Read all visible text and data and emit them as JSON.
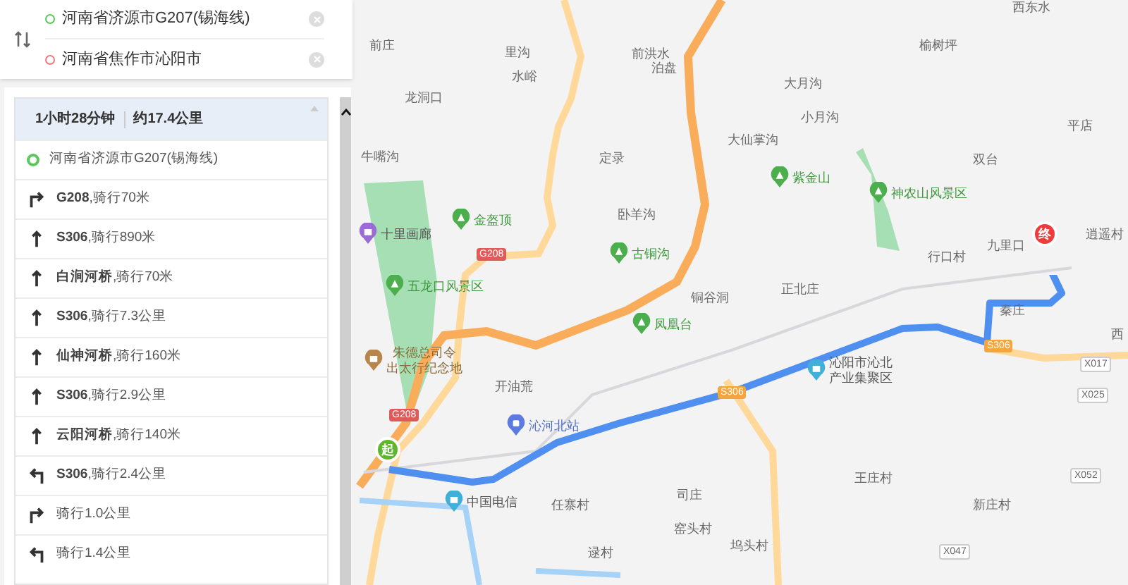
{
  "route_inputs": [
    {
      "kind": "start",
      "value": "河南省济源市G207(锡海线)"
    },
    {
      "kind": "end",
      "value": "河南省焦作市沁阳市"
    }
  ],
  "summary": {
    "duration": "1小时28分钟",
    "distance": "约17.4公里"
  },
  "steps": [
    {
      "kind": "start",
      "text": "河南省济源市G207(锡海线)"
    },
    {
      "kind": "right",
      "text": "**G208**,骑行70米"
    },
    {
      "kind": "straight",
      "text": "**S306**,骑行890米"
    },
    {
      "kind": "straight",
      "text": "**白涧河桥**,骑行70米"
    },
    {
      "kind": "straight",
      "text": "**S306**,骑行7.3公里"
    },
    {
      "kind": "straight",
      "text": "**仙神河桥**,骑行160米"
    },
    {
      "kind": "straight",
      "text": "**S306**,骑行2.9公里"
    },
    {
      "kind": "straight",
      "text": "**云阳河桥**,骑行140米"
    },
    {
      "kind": "left",
      "text": "**S306**,骑行2.4公里"
    },
    {
      "kind": "right",
      "text": "骑行1.0公里"
    },
    {
      "kind": "left",
      "text": "骑行1.4公里"
    }
  ],
  "map": {
    "start_marker": "起",
    "end_marker": "终",
    "labels": [
      {
        "kind": "place",
        "lines": [
          "前洪水"
        ]
      },
      {
        "kind": "place",
        "lines": [
          "前庄"
        ]
      },
      {
        "kind": "place",
        "lines": [
          "里沟"
        ]
      },
      {
        "kind": "place",
        "lines": [
          "水峪"
        ]
      },
      {
        "kind": "place",
        "lines": [
          "龙洞口"
        ]
      },
      {
        "kind": "place",
        "lines": [
          "泊盘"
        ]
      },
      {
        "kind": "place",
        "lines": [
          "大仙掌沟"
        ]
      },
      {
        "kind": "place",
        "lines": [
          "牛嘴沟"
        ]
      },
      {
        "kind": "place",
        "lines": [
          "定录"
        ]
      },
      {
        "kind": "shop",
        "lines": [
          "十里画廊"
        ]
      },
      {
        "kind": "scenic",
        "lines": [
          "金盔顶"
        ]
      },
      {
        "kind": "place",
        "lines": [
          "卧羊沟"
        ]
      },
      {
        "kind": "scenic",
        "lines": [
          "古铜沟"
        ]
      },
      {
        "kind": "scenic",
        "lines": [
          "五龙口风景区"
        ]
      },
      {
        "kind": "place",
        "lines": [
          "铜谷洞"
        ]
      },
      {
        "kind": "scenic",
        "lines": [
          "凤凰台"
        ]
      },
      {
        "kind": "memorial",
        "lines": [
          "朱德总司令",
          "出太行纪念地"
        ]
      },
      {
        "kind": "place",
        "lines": [
          "开油荒"
        ]
      },
      {
        "kind": "station",
        "lines": [
          "沁河北站"
        ]
      },
      {
        "kind": "telecom",
        "lines": [
          "中国电信"
        ]
      },
      {
        "kind": "place",
        "lines": [
          "任寨村"
        ]
      },
      {
        "kind": "place",
        "lines": [
          "司庄"
        ]
      },
      {
        "kind": "place",
        "lines": [
          "窑头村"
        ]
      },
      {
        "kind": "place",
        "lines": [
          "逯村"
        ]
      },
      {
        "kind": "place",
        "lines": [
          "坞头村"
        ]
      },
      {
        "kind": "place",
        "lines": [
          "西东水"
        ]
      },
      {
        "kind": "place",
        "lines": [
          "榆树坪"
        ]
      },
      {
        "kind": "place",
        "lines": [
          "大月沟"
        ]
      },
      {
        "kind": "place",
        "lines": [
          "小月沟"
        ]
      },
      {
        "kind": "scenic",
        "lines": [
          "紫金山"
        ]
      },
      {
        "kind": "scenic",
        "lines": [
          "神农山风景区"
        ]
      },
      {
        "kind": "place",
        "lines": [
          "双台"
        ]
      },
      {
        "kind": "place",
        "lines": [
          "平店"
        ]
      },
      {
        "kind": "place",
        "lines": [
          "逍遥村"
        ]
      },
      {
        "kind": "place",
        "lines": [
          "九里口"
        ]
      },
      {
        "kind": "place",
        "lines": [
          "行口村"
        ]
      },
      {
        "kind": "place",
        "lines": [
          "正北庄"
        ]
      },
      {
        "kind": "place",
        "lines": [
          "秦庄"
        ]
      },
      {
        "kind": "industry",
        "lines": [
          "沁阳市沁北",
          "产业集聚区"
        ]
      },
      {
        "kind": "place",
        "lines": [
          "王庄村"
        ]
      },
      {
        "kind": "place",
        "lines": [
          "新庄村"
        ]
      },
      {
        "kind": "place",
        "lines": [
          "西"
        ]
      }
    ],
    "shields": [
      {
        "kind": "national",
        "text": "G208"
      },
      {
        "kind": "national",
        "text": "G208"
      },
      {
        "kind": "provincial",
        "text": "S306"
      },
      {
        "kind": "provincial",
        "text": "S306"
      },
      {
        "kind": "county",
        "text": "X017"
      },
      {
        "kind": "county",
        "text": "X025"
      },
      {
        "kind": "county",
        "text": "X052"
      },
      {
        "kind": "county",
        "text": "X047"
      }
    ]
  }
}
